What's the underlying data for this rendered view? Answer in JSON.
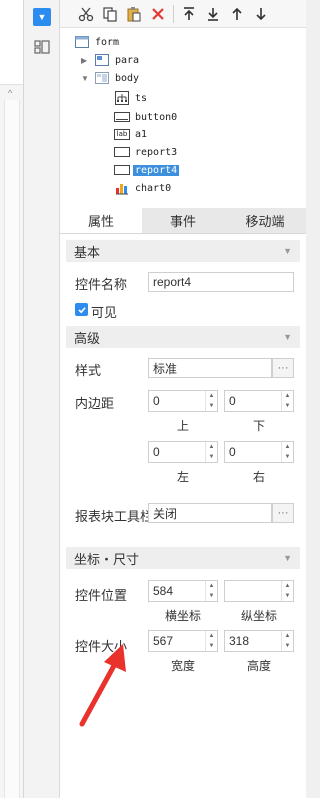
{
  "tree": {
    "nodes": [
      {
        "label": "form"
      },
      {
        "label": "para"
      },
      {
        "label": "body"
      },
      {
        "label": "ts"
      },
      {
        "label": "button0"
      },
      {
        "label": "a1"
      },
      {
        "label": "report3"
      },
      {
        "label": "report4"
      },
      {
        "label": "chart0"
      }
    ],
    "lab_icon_text": "lab"
  },
  "tabs": [
    {
      "label": "属性"
    },
    {
      "label": "事件"
    },
    {
      "label": "移动端"
    }
  ],
  "sections": {
    "basic": "基本",
    "advanced": "高级",
    "coords": "坐标・尺寸"
  },
  "basic": {
    "name_label": "控件名称",
    "name_value": "report4",
    "visible_label": "可见"
  },
  "advanced": {
    "style_label": "样式",
    "style_value": "标准",
    "padding_label": "内边距",
    "padding_top": "0",
    "padding_bottom": "0",
    "padding_left": "0",
    "padding_right": "0",
    "top_label": "上",
    "bottom_label": "下",
    "left_label": "左",
    "right_label": "右",
    "toolbar_label": "报表块工具栏",
    "toolbar_value": "关闭"
  },
  "coords": {
    "position_label": "控件位置",
    "x_value": "584",
    "y_value": "",
    "x_label": "横坐标",
    "y_label": "纵坐标",
    "size_label": "控件大小",
    "width_value": "567",
    "height_value": "318",
    "width_label": "宽度",
    "height_label": "高度"
  },
  "colors": {
    "accent": "#2d8cf0",
    "selection": "#3c8fdd",
    "annotation": "#e8322b"
  }
}
